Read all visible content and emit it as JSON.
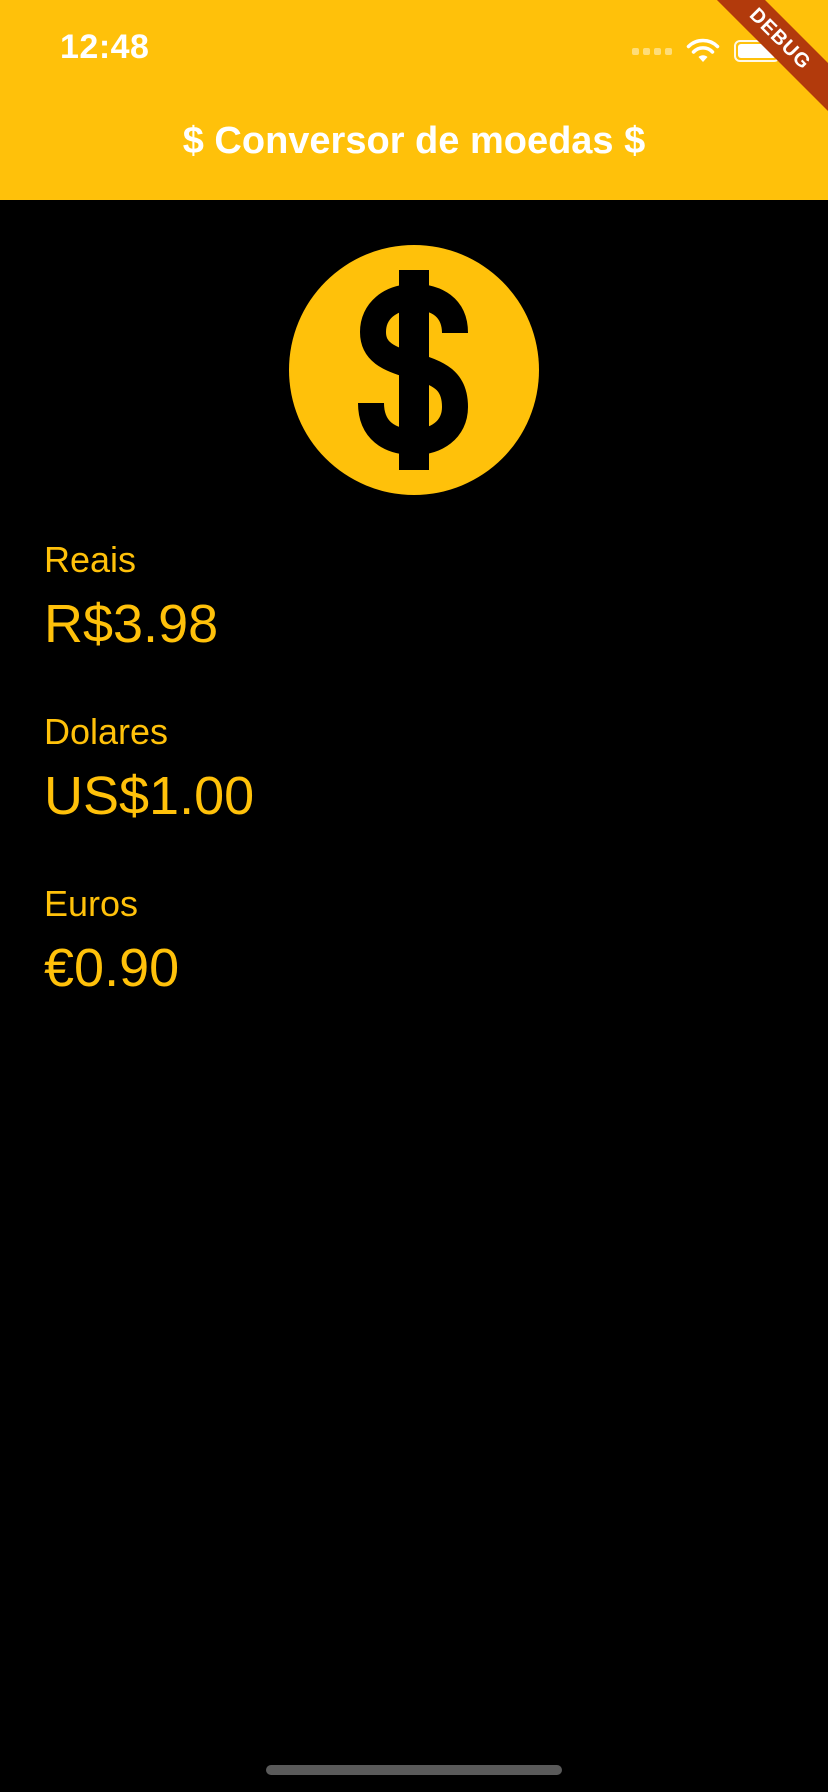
{
  "status_bar": {
    "time": "12:48"
  },
  "app_bar": {
    "title": "$ Conversor de moedas $",
    "debug_banner": "DEBUG"
  },
  "colors": {
    "accent": "#FFC10A",
    "background": "#000000",
    "debug_banner": "#B23A0C"
  },
  "icons": {
    "hero": "dollar-coin-icon"
  },
  "currencies": [
    {
      "label": "Reais",
      "value": "R$3.98"
    },
    {
      "label": "Dolares",
      "value": "US$1.00"
    },
    {
      "label": "Euros",
      "value": "€0.90"
    }
  ]
}
